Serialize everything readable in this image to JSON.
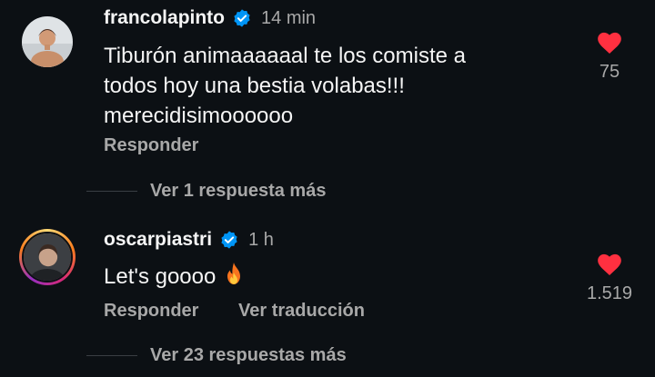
{
  "colors": {
    "background": "#0c1014",
    "text": "#f5f5f5",
    "muted": "#a8a8a8",
    "verified": "#0095f6",
    "heart": "#ff3040"
  },
  "comments": [
    {
      "username": "francolapinto",
      "verified_icon": "verified-badge-icon",
      "time": "14 min",
      "text_lines": [
        "Tiburón animaaaaaal te los comiste a",
        "todos hoy una bestia volabas!!!",
        "merecidisimoooooo"
      ],
      "reply_label": "Responder",
      "likes": "75",
      "like_icon": "heart-filled-icon",
      "more_replies": "Ver 1 respuesta más"
    },
    {
      "username": "oscarpiastri",
      "verified_icon": "verified-badge-icon",
      "time": "1 h",
      "text": "Let's goooo",
      "emoji_icon": "fire-icon",
      "reply_label": "Responder",
      "translate_label": "Ver traducción",
      "likes": "1.519",
      "like_icon": "heart-filled-icon",
      "more_replies": "Ver 23 respuestas más"
    }
  ]
}
